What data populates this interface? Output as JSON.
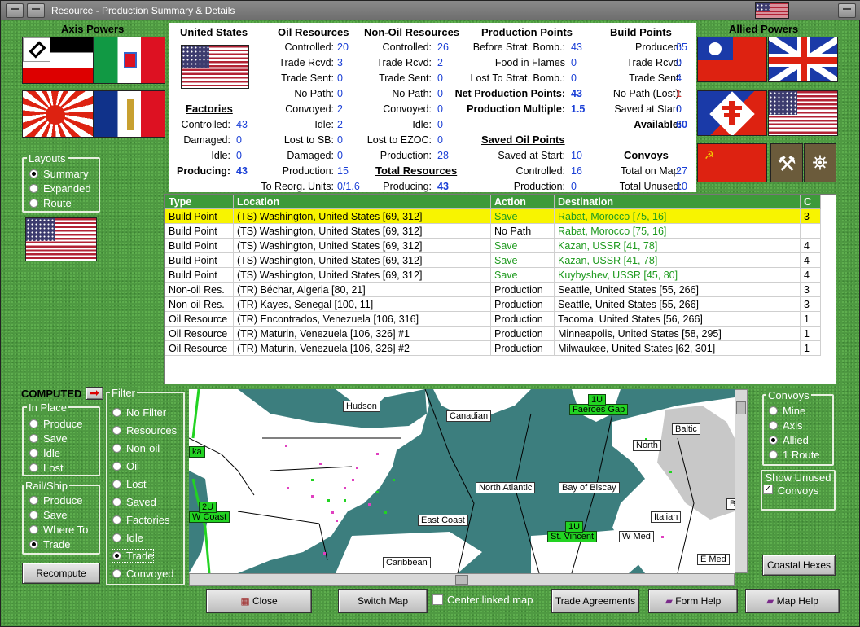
{
  "window": {
    "title": "Resource - Production Summary & Details"
  },
  "axis": {
    "title": "Axis Powers"
  },
  "allied": {
    "title": "Allied Powers"
  },
  "layouts": {
    "title": "Layouts",
    "options": [
      "Summary",
      "Expanded",
      "Route"
    ],
    "selected": "Summary"
  },
  "country": {
    "name": "United States"
  },
  "factories": {
    "title": "Factories",
    "rows": [
      {
        "label": "Controlled:",
        "value": "43"
      },
      {
        "label": "Damaged:",
        "value": "0"
      },
      {
        "label": "Idle:",
        "value": "0"
      },
      {
        "label": "Producing:",
        "value": "43"
      }
    ]
  },
  "oil": {
    "title": "Oil Resources",
    "rows": [
      {
        "label": "Controlled:",
        "value": "20"
      },
      {
        "label": "Trade Rcvd:",
        "value": "3"
      },
      {
        "label": "Trade Sent:",
        "value": "0"
      },
      {
        "label": "No Path:",
        "value": "0"
      },
      {
        "label": "Convoyed:",
        "value": "2"
      },
      {
        "label": "Idle:",
        "value": "2"
      },
      {
        "label": "Lost to SB:",
        "value": "0"
      },
      {
        "label": "Damaged:",
        "value": "0"
      },
      {
        "label": "Production:",
        "value": "15"
      },
      {
        "label": "To Reorg. Units:",
        "value": "0/1.6"
      }
    ]
  },
  "nonoil": {
    "title": "Non-Oil Resources",
    "rows": [
      {
        "label": "Controlled:",
        "value": "26"
      },
      {
        "label": "Trade Rcvd:",
        "value": "2"
      },
      {
        "label": "Trade Sent:",
        "value": "0"
      },
      {
        "label": "No Path:",
        "value": "0"
      },
      {
        "label": "Convoyed:",
        "value": "0"
      },
      {
        "label": "Idle:",
        "value": "0"
      },
      {
        "label": "Lost to EZOC:",
        "value": "0"
      },
      {
        "label": "Production:",
        "value": "28"
      }
    ]
  },
  "total": {
    "title": "Total Resources",
    "label": "Producing:",
    "value": "43"
  },
  "pp": {
    "title": "Production Points",
    "rows": [
      {
        "label": "Before Strat. Bomb.:",
        "value": "43"
      },
      {
        "label": "Food in Flames",
        "value": "0"
      },
      {
        "label": "Lost To Strat. Bomb.:",
        "value": "0"
      },
      {
        "label": "Net Production Points:",
        "value": "43"
      },
      {
        "label": "Production Multiple:",
        "value": "1.5"
      }
    ]
  },
  "saved": {
    "title": "Saved Oil Points",
    "rows": [
      {
        "label": "Saved at Start:",
        "value": "10"
      },
      {
        "label": "Controlled:",
        "value": "16"
      },
      {
        "label": "Production:",
        "value": "0"
      }
    ]
  },
  "bp": {
    "title": "Build Points",
    "rows": [
      {
        "label": "Produced:",
        "value": "65"
      },
      {
        "label": "Trade Rcvd:",
        "value": "0"
      },
      {
        "label": "Trade Sent:",
        "value": "4"
      },
      {
        "label": "No Path (Lost):",
        "value": "1"
      },
      {
        "label": "Saved at Start:",
        "value": "0"
      },
      {
        "label": "Available:",
        "value": "60"
      }
    ]
  },
  "convoys_info": {
    "title": "Convoys",
    "rows": [
      {
        "label": "Total on Map:",
        "value": "27"
      },
      {
        "label": "Total Unused:",
        "value": "10"
      }
    ]
  },
  "table": {
    "headers": [
      "Type",
      "Location",
      "Action",
      "Destination",
      "C"
    ],
    "rows": [
      {
        "type": "Build Point",
        "location": "(TS) Washington, United States [69, 312]",
        "action": "Save",
        "dest": "Rabat, Morocco [75, 16]",
        "c": "3"
      },
      {
        "type": "Build Point",
        "location": "(TS) Washington, United States [69, 312]",
        "action": "No Path",
        "dest": "Rabat, Morocco [75, 16]",
        "c": ""
      },
      {
        "type": "Build Point",
        "location": "(TS) Washington, United States [69, 312]",
        "action": "Save",
        "dest": "Kazan, USSR [41, 78]",
        "c": "4"
      },
      {
        "type": "Build Point",
        "location": "(TS) Washington, United States [69, 312]",
        "action": "Save",
        "dest": "Kazan, USSR [41, 78]",
        "c": "4"
      },
      {
        "type": "Build Point",
        "location": "(TS) Washington, United States [69, 312]",
        "action": "Save",
        "dest": "Kuybyshev, USSR [45, 80]",
        "c": "4"
      },
      {
        "type": "Non-oil Res.",
        "location": "(TR) Béchar, Algeria [80, 21]",
        "action": "Production",
        "dest": "Seattle, United States [55, 266]",
        "c": "3"
      },
      {
        "type": "Non-oil Res.",
        "location": "(TR) Kayes, Senegal [100, 11]",
        "action": "Production",
        "dest": "Seattle, United States [55, 266]",
        "c": "3"
      },
      {
        "type": "Oil Resource",
        "location": "(TR) Encontrados, Venezuela [106, 316]",
        "action": "Production",
        "dest": "Tacoma, United States [56, 266]",
        "c": "1"
      },
      {
        "type": "Oil Resource",
        "location": "(TR) Maturin, Venezuela [106, 326] #1",
        "action": "Production",
        "dest": "Minneapolis, United States [58, 295]",
        "c": "1"
      },
      {
        "type": "Oil Resource",
        "location": "(TR) Maturin, Venezuela [106, 326] #2",
        "action": "Production",
        "dest": "Milwaukee, United States [62, 301]",
        "c": "1"
      }
    ]
  },
  "computed": {
    "label": "COMPUTED"
  },
  "inplace": {
    "title": "In Place",
    "options": [
      "Produce",
      "Save",
      "Idle",
      "Lost"
    ]
  },
  "railship": {
    "title": "Rail/Ship",
    "options": [
      "Produce",
      "Save",
      "Where To",
      "Trade"
    ],
    "selected": "Trade"
  },
  "filter": {
    "title": "Filter",
    "options": [
      "No Filter",
      "Resources",
      "Non-oil",
      "Oil",
      "Lost",
      "Saved",
      "Factories",
      "Idle",
      "Trade",
      "Convoyed"
    ],
    "selected": "Trade"
  },
  "convoys": {
    "title": "Convoys",
    "options": [
      "Mine",
      "Axis",
      "Allied",
      "1 Route"
    ],
    "selected": "Allied",
    "show_unused": "Show Unused Convoys"
  },
  "map": {
    "labels": [
      "Hudson",
      "Canadian",
      "North Atlantic",
      "Bay of Biscay",
      "East Coast",
      "Caribbean",
      "Baltic",
      "North",
      "Italian",
      "W Med",
      "E Med",
      "B"
    ],
    "green_labels": [
      "Faeroes Gap",
      "St. Vincent",
      "W Coast"
    ],
    "unit_tags": [
      "1U",
      "1U",
      "2U"
    ],
    "left_edge_label": "ka"
  },
  "buttons": {
    "recompute": "Recompute",
    "coastal": "Coastal Hexes",
    "close": "Close",
    "switch": "Switch Map",
    "center": "Center linked map",
    "trade": "Trade Agreements",
    "form_help": "Form Help",
    "map_help": "Map Help"
  }
}
